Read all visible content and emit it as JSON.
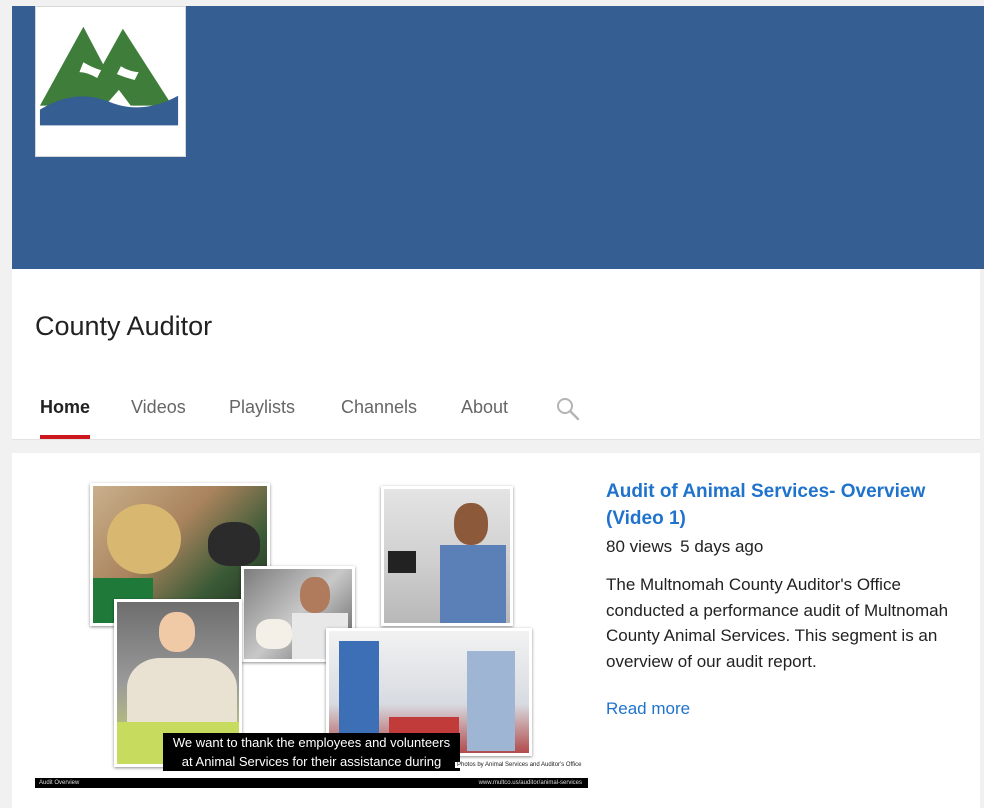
{
  "channel": {
    "name": "County Auditor",
    "banner_color": "#355e93",
    "logo_colors": {
      "mountain": "#3f7d3a",
      "water": "#355e93"
    }
  },
  "tabs": [
    {
      "label": "Home",
      "active": true
    },
    {
      "label": "Videos",
      "active": false
    },
    {
      "label": "Playlists",
      "active": false
    },
    {
      "label": "Channels",
      "active": false
    },
    {
      "label": "About",
      "active": false
    }
  ],
  "search_icon": "search-icon",
  "accent_color": "#cc181e",
  "featured_video": {
    "title": "Audit of Animal Services- Overview (Video 1)",
    "views": "80 views",
    "age": "5 days ago",
    "description": "The Multnomah County Auditor's Office conducted a performance audit of Multnomah County Animal Services. This segment is an overview of our audit report.",
    "read_more": "Read more",
    "thumbnail": {
      "caption_line1": "We want to thank the employees and volunteers",
      "caption_line2": "at Animal Services for their assistance during",
      "photo_credit": "Photos by Animal Services and Auditor's Office",
      "bottom_left": "Audit Overview",
      "bottom_right": "www.multco.us/auditor/animal-services"
    }
  }
}
